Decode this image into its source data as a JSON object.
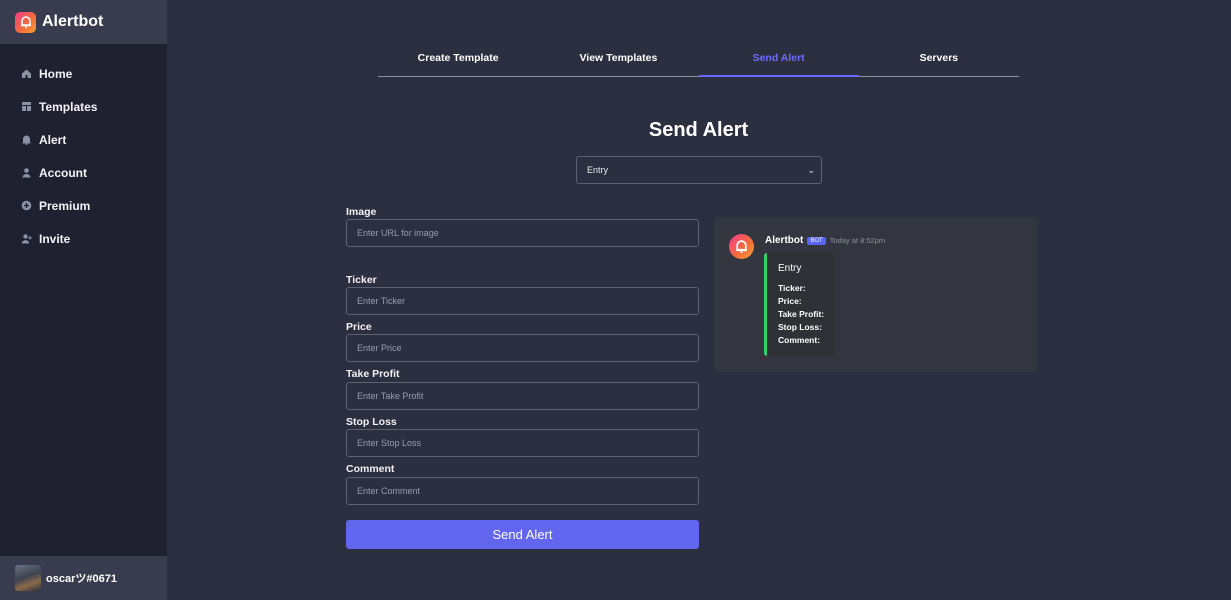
{
  "brand": {
    "title": "Alertbot"
  },
  "sidebar": {
    "items": [
      {
        "label": "Home",
        "icon": "home-icon"
      },
      {
        "label": "Templates",
        "icon": "templates-icon"
      },
      {
        "label": "Alert",
        "icon": "bell-icon"
      },
      {
        "label": "Account",
        "icon": "user-icon"
      },
      {
        "label": "Premium",
        "icon": "plus-circle-icon"
      },
      {
        "label": "Invite",
        "icon": "user-plus-icon"
      }
    ]
  },
  "user": {
    "name": "oscarツ#0671"
  },
  "tabs": [
    {
      "label": "Create Template",
      "active": false
    },
    {
      "label": "View Templates",
      "active": false
    },
    {
      "label": "Send Alert",
      "active": true
    },
    {
      "label": "Servers",
      "active": false
    }
  ],
  "page": {
    "title": "Send Alert"
  },
  "template_select": {
    "value": "Entry"
  },
  "form": {
    "image": {
      "label": "Image",
      "placeholder": "Enter URL for image"
    },
    "ticker": {
      "label": "Ticker",
      "placeholder": "Enter Ticker"
    },
    "price": {
      "label": "Price",
      "placeholder": "Enter Price"
    },
    "take_profit": {
      "label": "Take Profit",
      "placeholder": "Enter Take Profit"
    },
    "stop_loss": {
      "label": "Stop Loss",
      "placeholder": "Enter Stop Loss"
    },
    "comment": {
      "label": "Comment",
      "placeholder": "Enter Comment"
    },
    "submit_label": "Send Alert"
  },
  "preview": {
    "bot_name": "Alertbot",
    "badge": "BOT",
    "timestamp": "Today at 8:52pm",
    "embed_title": "Entry",
    "fields": [
      "Ticker:",
      "Price:",
      "Take Profit:",
      "Stop Loss:",
      "Comment:"
    ],
    "embed_color": "#34d16a"
  },
  "colors": {
    "accent": "#6b6cff",
    "button": "#6266ee",
    "sidebar": "#1f2130",
    "background": "#2c2f3f"
  }
}
